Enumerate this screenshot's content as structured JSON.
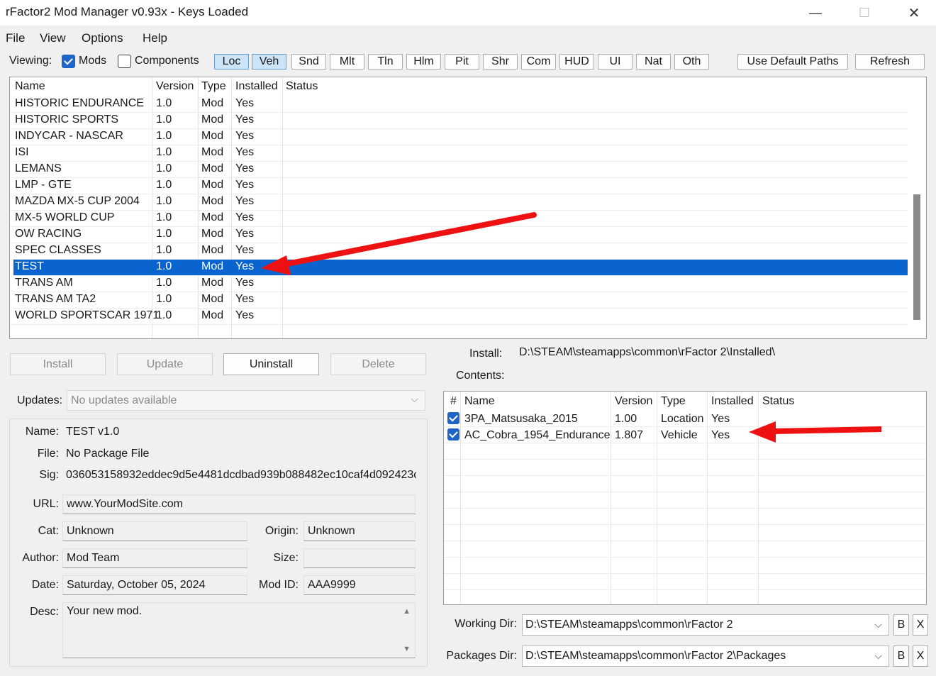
{
  "window": {
    "title": "rFactor2 Mod Manager v0.93x - Keys Loaded",
    "minimize": "—",
    "maximize": "☐",
    "close": "✕"
  },
  "menu": [
    "File",
    "View",
    "Options",
    "Help"
  ],
  "viewing": {
    "label": "Viewing:",
    "mods_label": "Mods",
    "mods_checked": true,
    "components_label": "Components",
    "components_checked": false,
    "filters": [
      {
        "label": "Loc",
        "active": true
      },
      {
        "label": "Veh",
        "active": true
      },
      {
        "label": "Snd",
        "active": false
      },
      {
        "label": "Mlt",
        "active": false
      },
      {
        "label": "Tln",
        "active": false
      },
      {
        "label": "Hlm",
        "active": false
      },
      {
        "label": "Pit",
        "active": false
      },
      {
        "label": "Shr",
        "active": false
      },
      {
        "label": "Com",
        "active": false
      },
      {
        "label": "HUD",
        "active": false
      },
      {
        "label": "UI",
        "active": false
      },
      {
        "label": "Nat",
        "active": false
      },
      {
        "label": "Oth",
        "active": false
      }
    ],
    "default_paths_label": "Use Default Paths",
    "refresh_label": "Refresh"
  },
  "mods": {
    "columns": [
      "Name",
      "Version",
      "Type",
      "Installed",
      "Status"
    ],
    "rows": [
      [
        "HISTORIC ENDURANCE",
        "1.0",
        "Mod",
        "Yes",
        ""
      ],
      [
        "HISTORIC SPORTS",
        "1.0",
        "Mod",
        "Yes",
        ""
      ],
      [
        "INDYCAR - NASCAR",
        "1.0",
        "Mod",
        "Yes",
        ""
      ],
      [
        "ISI",
        "1.0",
        "Mod",
        "Yes",
        ""
      ],
      [
        "LEMANS",
        "1.0",
        "Mod",
        "Yes",
        ""
      ],
      [
        "LMP - GTE",
        "1.0",
        "Mod",
        "Yes",
        ""
      ],
      [
        "MAZDA MX-5 CUP 2004",
        "1.0",
        "Mod",
        "Yes",
        ""
      ],
      [
        "MX-5 WORLD CUP",
        "1.0",
        "Mod",
        "Yes",
        ""
      ],
      [
        "OW RACING",
        "1.0",
        "Mod",
        "Yes",
        ""
      ],
      [
        "SPEC CLASSES",
        "1.0",
        "Mod",
        "Yes",
        ""
      ],
      [
        "TEST",
        "1.0",
        "Mod",
        "Yes",
        ""
      ],
      [
        "TRANS AM",
        "1.0",
        "Mod",
        "Yes",
        ""
      ],
      [
        "TRANS AM TA2",
        "1.0",
        "Mod",
        "Yes",
        ""
      ],
      [
        "WORLD SPORTSCAR 1971",
        "1.0",
        "Mod",
        "Yes",
        ""
      ]
    ],
    "selected_index": 10
  },
  "actions": [
    {
      "label": "Install",
      "enabled": false
    },
    {
      "label": "Update",
      "enabled": false
    },
    {
      "label": "Uninstall",
      "enabled": true
    },
    {
      "label": "Delete",
      "enabled": false
    }
  ],
  "updates": {
    "label": "Updates:",
    "value": "No updates available"
  },
  "details": {
    "name_label": "Name:",
    "name": "TEST v1.0",
    "file_label": "File:",
    "file": "No Package File",
    "sig_label": "Sig:",
    "sig": "036053158932eddec9d5e4481dcdbad939b088482ec10caf4d092423c",
    "url_label": "URL:",
    "url": "www.YourModSite.com",
    "cat_label": "Cat:",
    "cat": "Unknown",
    "origin_label": "Origin:",
    "origin": "Unknown",
    "author_label": "Author:",
    "author": "Mod Team",
    "size_label": "Size:",
    "size": "",
    "date_label": "Date:",
    "date": "Saturday, October 05, 2024",
    "modid_label": "Mod ID:",
    "modid": "AAA9999",
    "desc_label": "Desc:",
    "desc": "Your new mod."
  },
  "install": {
    "label": "Install:",
    "path": "D:\\STEAM\\steamapps\\common\\rFactor 2\\Installed\\"
  },
  "contents": {
    "label": "Contents:",
    "columns": [
      "#",
      "Name",
      "Version",
      "Type",
      "Installed",
      "Status"
    ],
    "rows": [
      {
        "checked": true,
        "name": "3PA_Matsusaka_2015",
        "version": "1.00",
        "type": "Location",
        "installed": "Yes",
        "status": ""
      },
      {
        "checked": true,
        "name": "AC_Cobra_1954_Endurance",
        "version": "1.807",
        "type": "Vehicle",
        "installed": "Yes",
        "status": ""
      }
    ]
  },
  "dirs": {
    "working_label": "Working Dir:",
    "working": "D:\\STEAM\\steamapps\\common\\rFactor 2",
    "packages_label": "Packages Dir:",
    "packages": "D:\\STEAM\\steamapps\\common\\rFactor 2\\Packages",
    "browse": "B",
    "clear": "X"
  },
  "colors": {
    "selection": "#0a64d0",
    "arrow": "#ee1111",
    "active_filter": "#cce4f7",
    "checkbox": "#1f65c8"
  }
}
